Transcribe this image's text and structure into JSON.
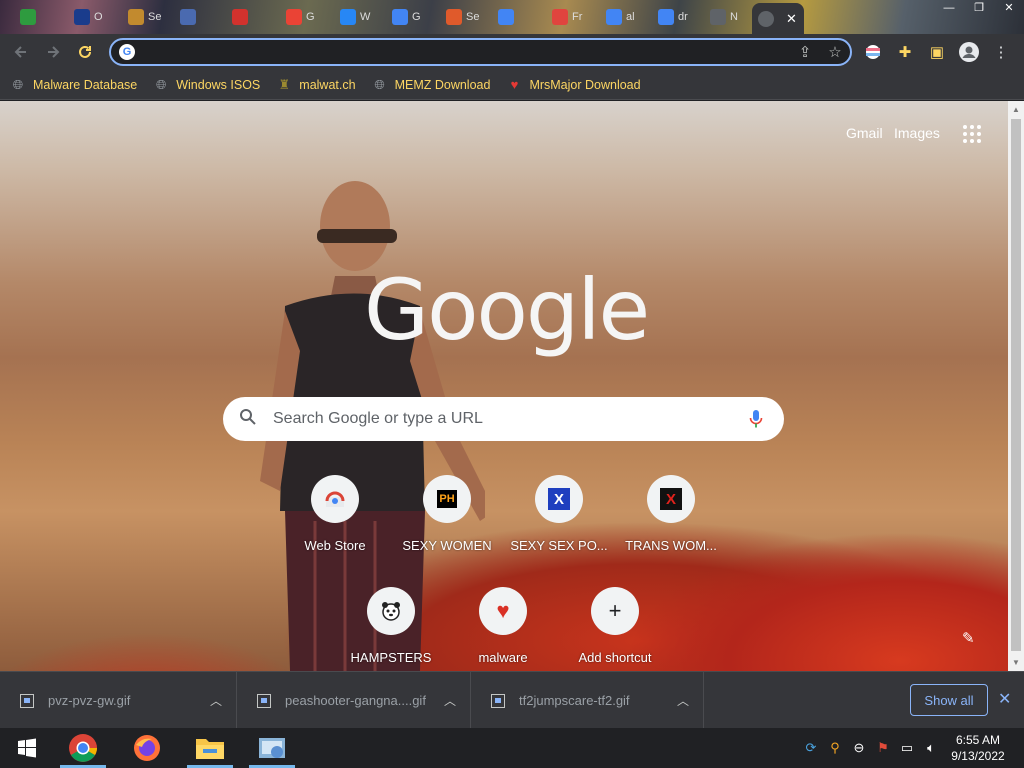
{
  "browser": {
    "tabs": [
      {
        "icon": "green-circle-icon",
        "color": "#2e9b3f",
        "title": ""
      },
      {
        "icon": "ov-icon",
        "color": "#1a3c8c",
        "title": "O"
      },
      {
        "icon": "emblem-icon",
        "color": "#c28a2e",
        "title": "Se"
      },
      {
        "icon": "ant-icon",
        "color": "#4a6ab0",
        "title": ""
      },
      {
        "icon": "opera-icon",
        "color": "#d2322d",
        "title": ""
      },
      {
        "icon": "gmail-icon",
        "color": "#ea4335",
        "title": "G"
      },
      {
        "icon": "vk-icon",
        "color": "#2787f5",
        "title": "W"
      },
      {
        "icon": "google-icon",
        "color": "#4285f4",
        "title": "G"
      },
      {
        "icon": "tool-icon",
        "color": "#e05a2b",
        "title": "Se"
      },
      {
        "icon": "google-icon",
        "color": "#4285f4",
        "title": ""
      },
      {
        "icon": "tree-icon",
        "color": "#e0443e",
        "title": "Fr"
      },
      {
        "icon": "google-icon",
        "color": "#4285f4",
        "title": "al"
      },
      {
        "icon": "google-icon",
        "color": "#4285f4",
        "title": "dr"
      },
      {
        "icon": "chrome-icon",
        "color": "#5f6368",
        "title": "N"
      },
      {
        "icon": "google-icon",
        "color": "#4285f4",
        "title": ""
      }
    ],
    "active_tab_close": "✕",
    "window_controls": [
      "—",
      "❐",
      "✕"
    ],
    "address": {
      "value": "",
      "placeholder": ""
    },
    "bookmarks": [
      {
        "label": "Malware Database",
        "icon": "globe-icon"
      },
      {
        "label": "Windows ISOS",
        "icon": "globe-icon"
      },
      {
        "label": "malwat.ch",
        "icon": "malwatch-icon"
      },
      {
        "label": "MEMZ Download",
        "icon": "globe-icon"
      },
      {
        "label": "MrsMajor Download",
        "icon": "heart-icon"
      }
    ]
  },
  "ntp": {
    "gmail": "Gmail",
    "images": "Images",
    "logo": "Google",
    "search_placeholder": "Search Google or type a URL",
    "shortcuts": [
      {
        "label": "Web Store",
        "icon": "chrome-webstore-icon"
      },
      {
        "label": "SEXY WOMEN",
        "icon": "ph-icon"
      },
      {
        "label": "SEXY SEX PO...",
        "icon": "blue-x-icon"
      },
      {
        "label": "TRANS WOM...",
        "icon": "red-x-icon"
      },
      {
        "label": "HAMPSTERS",
        "icon": "hamster-icon"
      },
      {
        "label": "malware",
        "icon": "heart-icon"
      },
      {
        "label": "Add shortcut",
        "icon": "plus-icon"
      }
    ]
  },
  "downloads": {
    "items": [
      {
        "name": "pvz-pvz-gw.gif"
      },
      {
        "name": "peashooter-gangna....gif"
      },
      {
        "name": "tf2jumpscare-tf2.gif"
      }
    ],
    "show_all": "Show all"
  },
  "taskbar": {
    "time": "6:55 AM",
    "date": "9/13/2022"
  },
  "colors": {
    "accent_blue": "#8ab4f8",
    "bookmark_text": "#fdd663",
    "toolbar_bg": "#35363a"
  }
}
